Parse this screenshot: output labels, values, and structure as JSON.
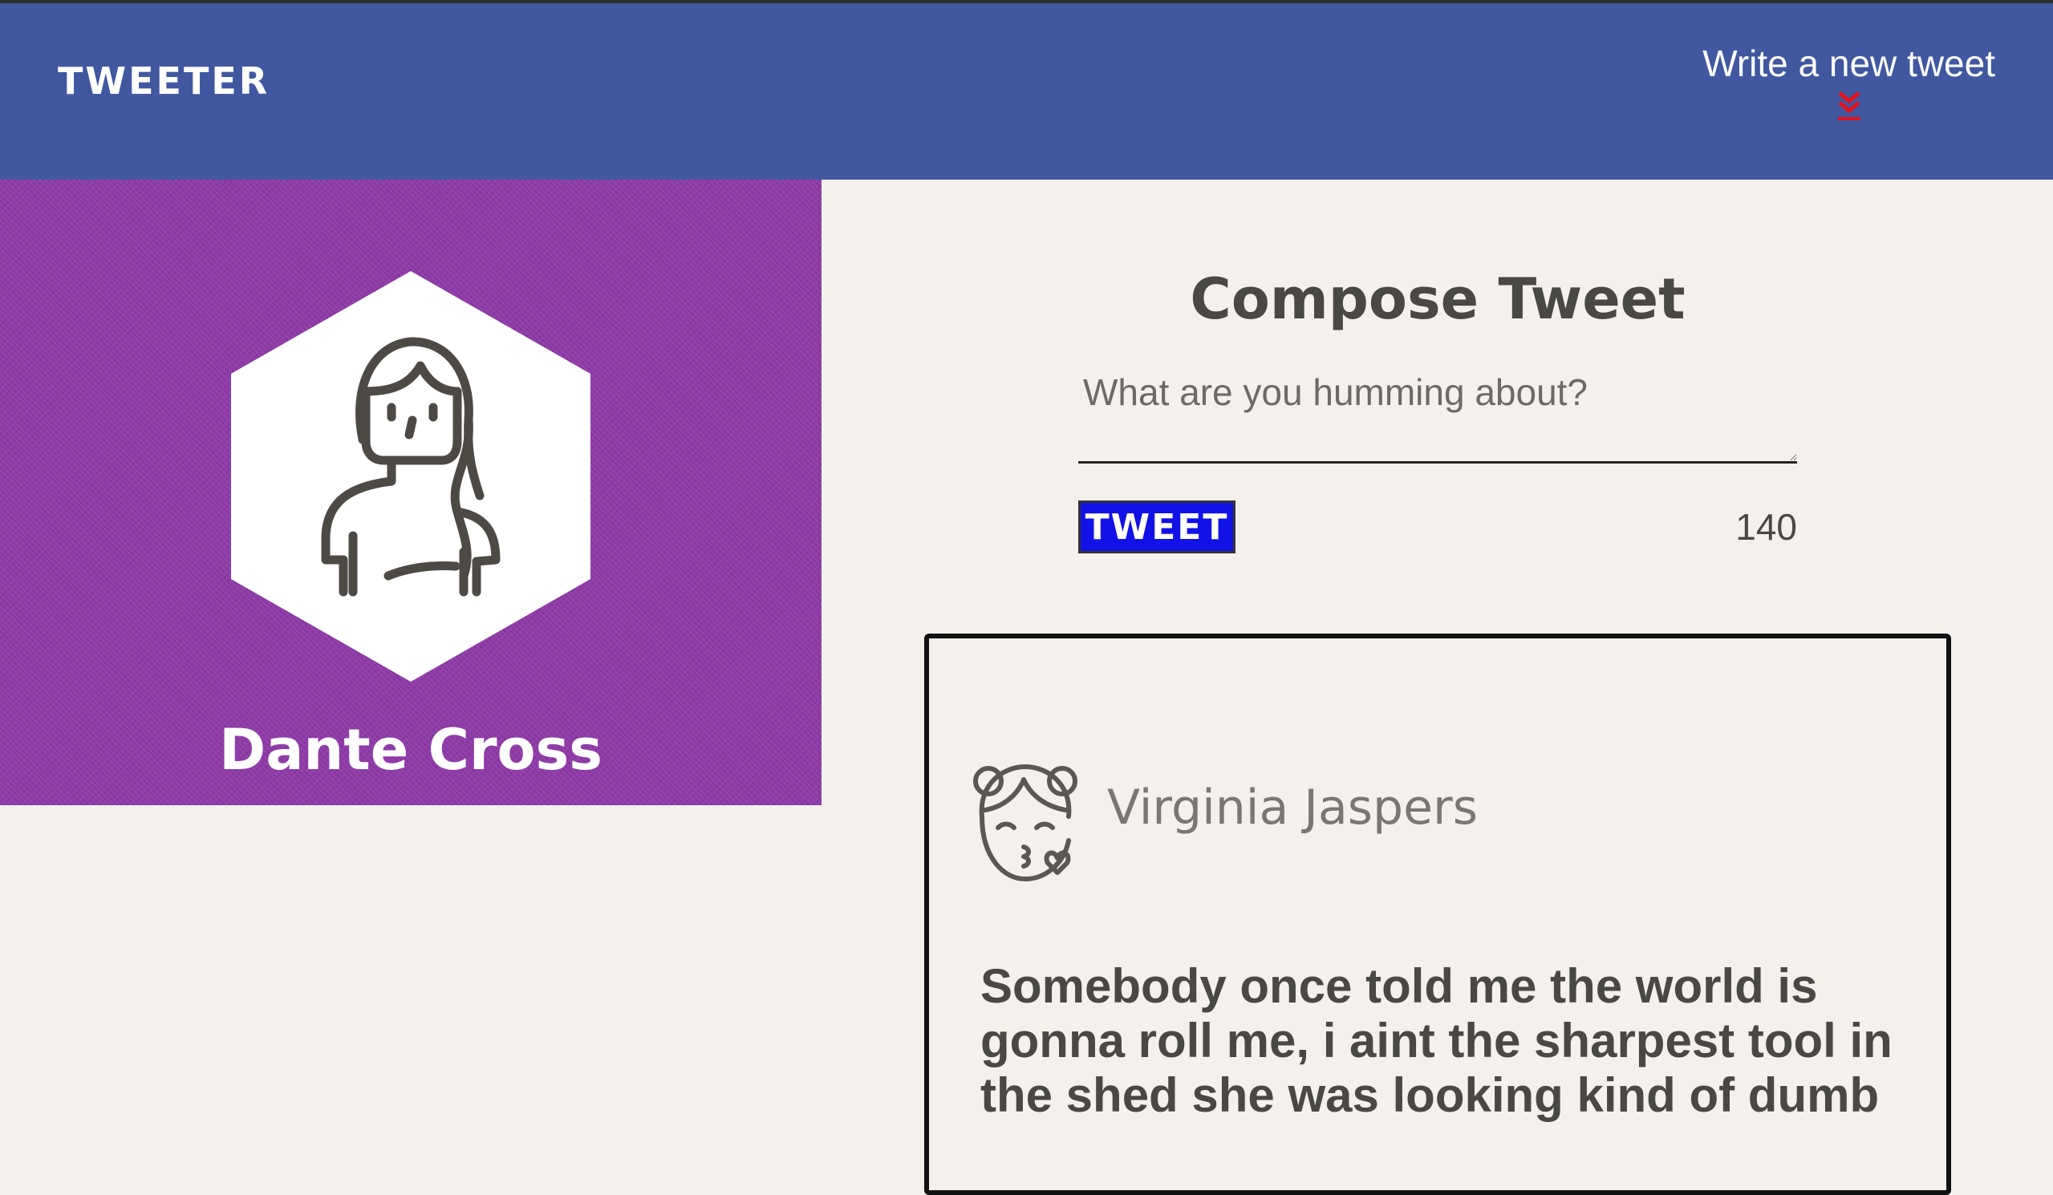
{
  "nav": {
    "brand": "TWEETER",
    "compose_link": "Write a new tweet",
    "compose_link_icon": "double-chevron-down-icon",
    "background_color": "#4158a0",
    "chevron_color": "#e4121b"
  },
  "profile": {
    "name": "Dante Cross",
    "avatar_icon": "woman-avatar-icon",
    "background_color": "#8e3aa8"
  },
  "compose": {
    "title": "Compose Tweet",
    "placeholder": "What are you humming about?",
    "button_label": "TWEET",
    "char_count": "140",
    "button_color": "#1212e6"
  },
  "tweets": [
    {
      "author": "Virginia Jaspers",
      "avatar_icon": "girl-kiss-avatar-icon",
      "text": "Somebody once told me the world is gonna roll me, i aint the sharpest tool in the shed she was looking kind of dumb"
    }
  ]
}
